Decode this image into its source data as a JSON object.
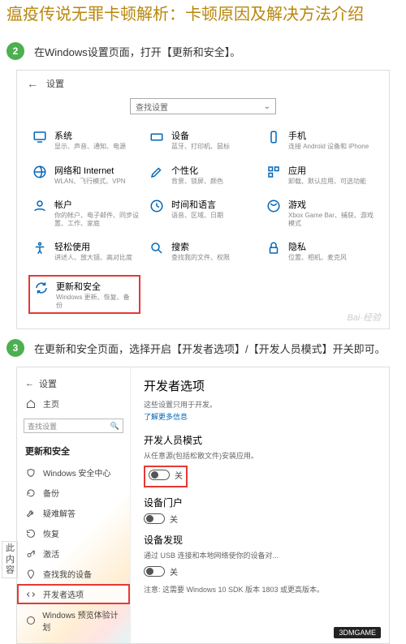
{
  "page": {
    "title": "瘟疫传说无罪卡顿解析：卡顿原因及解决方法介绍"
  },
  "step2": {
    "num": "2",
    "text": "在Windows设置页面，打开【更新和安全】。"
  },
  "step3": {
    "num": "3",
    "text": "在更新和安全页面，选择开启【开发者选项】/【开发人员模式】开关即可。"
  },
  "settings": {
    "back": "←",
    "title": "设置",
    "search_placeholder": "查找设置",
    "items": [
      {
        "label": "系统",
        "sub": "显示、声音、通知、电源"
      },
      {
        "label": "设备",
        "sub": "蓝牙、打印机、鼠标"
      },
      {
        "label": "手机",
        "sub": "连接 Android 设备和 iPhone"
      },
      {
        "label": "网络和 Internet",
        "sub": "WLAN、飞行模式、VPN"
      },
      {
        "label": "个性化",
        "sub": "背景、锁屏、颜色"
      },
      {
        "label": "应用",
        "sub": "卸载、默认应用、可选功能"
      },
      {
        "label": "帐户",
        "sub": "你的帐户、电子邮件、同步设置、工作、家庭"
      },
      {
        "label": "时间和语言",
        "sub": "语音、区域、日期"
      },
      {
        "label": "游戏",
        "sub": "Xbox Game Bar、捕获、游戏模式"
      },
      {
        "label": "轻松使用",
        "sub": "讲述人、放大镜、高对比度"
      },
      {
        "label": "搜索",
        "sub": "查找我的文件、权限"
      },
      {
        "label": "隐私",
        "sub": "位置、相机、麦克风"
      },
      {
        "label": "更新和安全",
        "sub": "Windows 更新、恢复、备份"
      }
    ],
    "watermark": "Bai·经验"
  },
  "dev": {
    "window_title": "设置",
    "home": "主页",
    "search_placeholder": "查找设置",
    "section": "更新和安全",
    "sidebar": [
      {
        "label": "Windows 安全中心"
      },
      {
        "label": "备份"
      },
      {
        "label": "疑难解答"
      },
      {
        "label": "恢复"
      },
      {
        "label": "激活"
      },
      {
        "label": "查找我的设备"
      },
      {
        "label": "开发者选项"
      },
      {
        "label": "Windows 预览体验计划"
      }
    ],
    "content": {
      "title": "开发者选项",
      "sub": "这些设置只用于开发。",
      "link": "了解更多信息",
      "mode_label": "开发人员模式",
      "mode_desc": "从任意源(包括松散文件)安装应用。",
      "toggle_state": "关",
      "portal_label": "设备门户",
      "portal_desc": "",
      "discovery_label": "设备发现",
      "discovery_desc": "通过 USB 连接和本地网络使你的设备对...",
      "note": "注意: 这需要 Windows 10 SDK 版本 1803 或更高版本。"
    },
    "brand": "3DMGAME"
  },
  "sidenote": "此内容"
}
